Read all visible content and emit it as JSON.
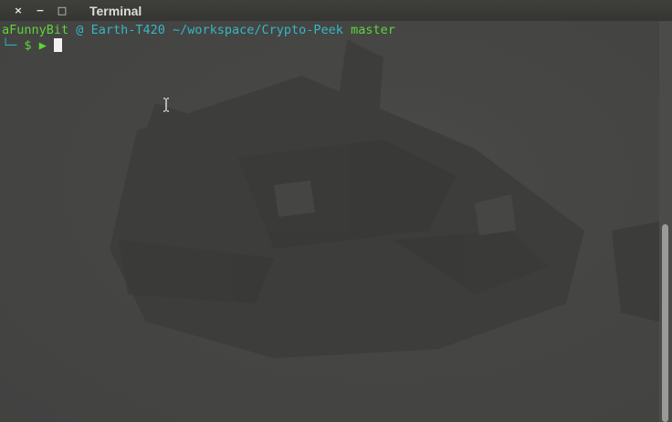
{
  "window": {
    "title": "Terminal",
    "controls": {
      "close": "×",
      "minimize": "−",
      "maximize": "□"
    }
  },
  "prompt": {
    "user": "aFunnyBit",
    "at": "@",
    "host": "Earth-T420",
    "path": "~/workspace/Crypto-Peek",
    "branch": "master",
    "corner": "└─",
    "dollar": "$",
    "arrow": "▶"
  },
  "colors": {
    "user": "#5fd43a",
    "host": "#34b8c4",
    "background": "#444443",
    "titlebar": "#3a3a38"
  },
  "scrollbar": {
    "position_fraction": 0.5,
    "visible_fraction": 0.49
  }
}
